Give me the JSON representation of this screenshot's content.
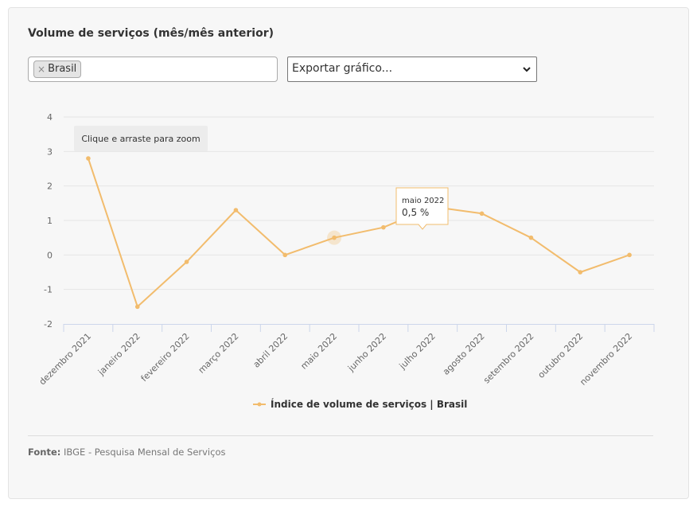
{
  "header": {
    "title": "Volume de serviços (mês/mês anterior)"
  },
  "filter": {
    "selected_tag": "Brasil",
    "remove_symbol": "×"
  },
  "export": {
    "label": "Exportar gráfico..."
  },
  "zoom_hint": "Clique e arraste para zoom",
  "tooltip": {
    "title": "maio 2022",
    "value": "0,5 %"
  },
  "chart_data": {
    "type": "line",
    "title": "Volume de serviços (mês/mês anterior)",
    "categories": [
      "dezembro 2021",
      "janeiro 2022",
      "fevereiro 2022",
      "março 2022",
      "abril 2022",
      "maio 2022",
      "junho 2022",
      "julho 2022",
      "agosto 2022",
      "setembro 2022",
      "outubro 2022",
      "novembro 2022"
    ],
    "series": [
      {
        "name": "Índice de volume de serviços | Brasil",
        "values": [
          2.8,
          -1.5,
          -0.2,
          1.3,
          0.0,
          0.5,
          0.8,
          1.4,
          1.2,
          0.5,
          -0.5,
          0.0
        ]
      }
    ],
    "ylim": [
      -2,
      4
    ],
    "yticks": [
      "4",
      "3",
      "2",
      "1",
      "0",
      "-1",
      "-2"
    ],
    "grid": true,
    "legend_position": "bottom-center",
    "highlighted_category": "maio 2022",
    "color": "#f2bc6d"
  },
  "source": {
    "label": "Fonte:",
    "text": "IBGE - Pesquisa Mensal de Serviços"
  }
}
